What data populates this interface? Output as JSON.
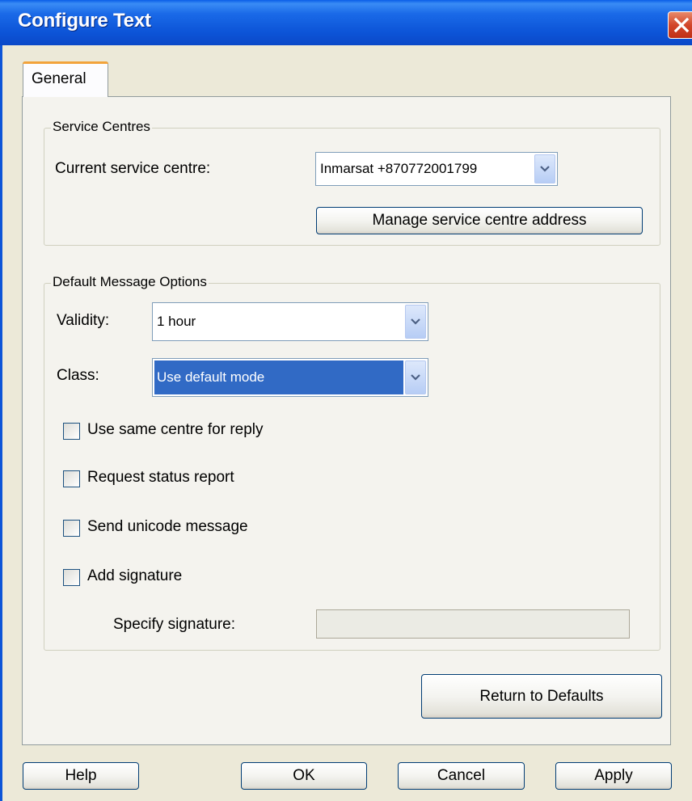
{
  "window": {
    "title": "Configure Text"
  },
  "tabs": [
    {
      "label": "General"
    }
  ],
  "service_centres": {
    "legend": "Service Centres",
    "current_label": "Current service centre:",
    "current_value": "Inmarsat +870772001799",
    "manage_button": "Manage service centre address"
  },
  "default_options": {
    "legend": "Default Message Options",
    "validity_label": "Validity:",
    "validity_value": "1 hour",
    "class_label": "Class:",
    "class_value": "Use default mode",
    "checkboxes": [
      {
        "label": "Use same centre for reply",
        "checked": false
      },
      {
        "label": "Request status report",
        "checked": false
      },
      {
        "label": "Send unicode message",
        "checked": false
      },
      {
        "label": "Add signature",
        "checked": false
      }
    ],
    "signature_label": "Specify signature:",
    "signature_value": ""
  },
  "return_defaults_button": "Return to Defaults",
  "footer": {
    "help": "Help",
    "ok": "OK",
    "cancel": "Cancel",
    "apply": "Apply"
  },
  "icons": {
    "close": "close-icon",
    "dropdown": "chevron-down-icon"
  }
}
